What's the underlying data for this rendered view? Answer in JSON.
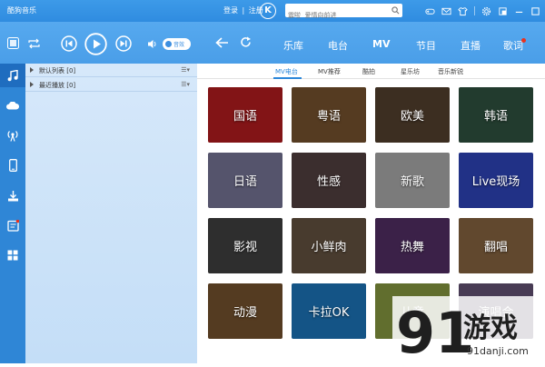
{
  "titlebar": {
    "app_title": "酷狗音乐",
    "login": "登录",
    "separator": "|",
    "register": "注册",
    "logo": "K",
    "search_placeholder": "震啦  爱情向前进"
  },
  "toolbar": {
    "volume_label": "音效"
  },
  "nav_tabs": [
    {
      "label": "乐库",
      "active": false
    },
    {
      "label": "电台",
      "active": false
    },
    {
      "label": "MV",
      "active": true
    },
    {
      "label": "节目",
      "active": false
    },
    {
      "label": "直播",
      "active": false
    },
    {
      "label": "歌词",
      "active": false
    }
  ],
  "sidebar_icons": [
    "music-note-icon",
    "cloud-icon",
    "radio-icon",
    "phone-icon",
    "download-icon",
    "inbox-icon",
    "apps-icon"
  ],
  "playlists": [
    {
      "name": "默认列表",
      "count": "[0]"
    },
    {
      "name": "最近播放",
      "count": "[0]"
    }
  ],
  "sub_tabs": [
    {
      "label": "MV电台",
      "active": true
    },
    {
      "label": "MV推荐",
      "active": false
    },
    {
      "label": "酷拍",
      "active": false
    },
    {
      "label": "星乐坊",
      "active": false
    },
    {
      "label": "音乐新锐",
      "active": false
    }
  ],
  "tiles": [
    {
      "label": "国语",
      "color": "#a3191c"
    },
    {
      "label": "粤语",
      "color": "#6b4a2a"
    },
    {
      "label": "欧美",
      "color": "#4b3a2a"
    },
    {
      "label": "韩语",
      "color": "#2b4a3a"
    },
    {
      "label": "日语",
      "color": "#6b6a88"
    },
    {
      "label": "性感",
      "color": "#4a3a3a"
    },
    {
      "label": "新歌",
      "color": "#9a9a9a"
    },
    {
      "label": "Live现场",
      "color": "#2a3ea8"
    },
    {
      "label": "影视",
      "color": "#3a3a3a"
    },
    {
      "label": "小鲜肉",
      "color": "#5a4a3a"
    },
    {
      "label": "热舞",
      "color": "#4a2a5a"
    },
    {
      "label": "翻唱",
      "color": "#7a5a3a"
    },
    {
      "label": "动漫",
      "color": "#6a4a2a"
    },
    {
      "label": "卡拉OK",
      "color": "#1a6aa8"
    },
    {
      "label": "儿童",
      "color": "#7a8a3a"
    },
    {
      "label": "演唱会",
      "color": "#5a4a6a"
    }
  ],
  "watermark": {
    "brand": "游戏",
    "url": "91danji.com",
    "digits": "91"
  }
}
